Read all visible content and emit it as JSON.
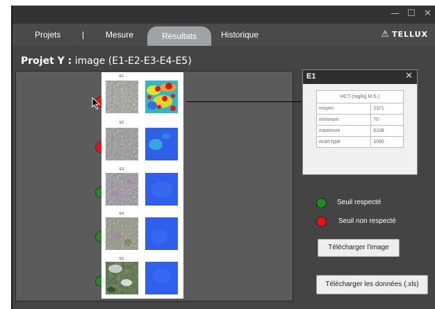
{
  "window": {
    "minimize_icon": "—",
    "maximize_icon": "☐",
    "close_icon": "✕"
  },
  "nav": {
    "tabs": [
      {
        "label": "Projets"
      },
      {
        "label": "|"
      },
      {
        "label": "Mesure"
      },
      {
        "label": "Résultats",
        "active": true
      },
      {
        "label": "Historique"
      }
    ],
    "brand": "TELLUX"
  },
  "page": {
    "title_bold": "Projet Y :",
    "title_rest": " image (E1-E2-E3-E4-E5)"
  },
  "samples": [
    {
      "label": "E1",
      "status": "red"
    },
    {
      "label": "E2",
      "status": "red"
    },
    {
      "label": "E3",
      "status": "green"
    },
    {
      "label": "E4",
      "status": "green"
    },
    {
      "label": "E5",
      "status": "green"
    }
  ],
  "popup": {
    "title": "E1",
    "header": "HCT (mg/kg M.S.)",
    "rows": [
      {
        "label": "moyen",
        "value": "2371"
      },
      {
        "label": "minimum",
        "value": "70"
      },
      {
        "label": "maximum",
        "value": "6108"
      },
      {
        "label": "ecart type",
        "value": "1090"
      }
    ]
  },
  "legend": {
    "ok": "Seuil respecté",
    "not_ok": "Seuil non respecté"
  },
  "buttons": {
    "download_image": "Télécharger l'image",
    "download_data": "Télécharger les données (.xls)"
  },
  "colors": {
    "status_red": "#ee1111",
    "status_green": "#1e8a22",
    "window_bg": "#3d3d3d",
    "active_tab": "#9fa3a8"
  }
}
